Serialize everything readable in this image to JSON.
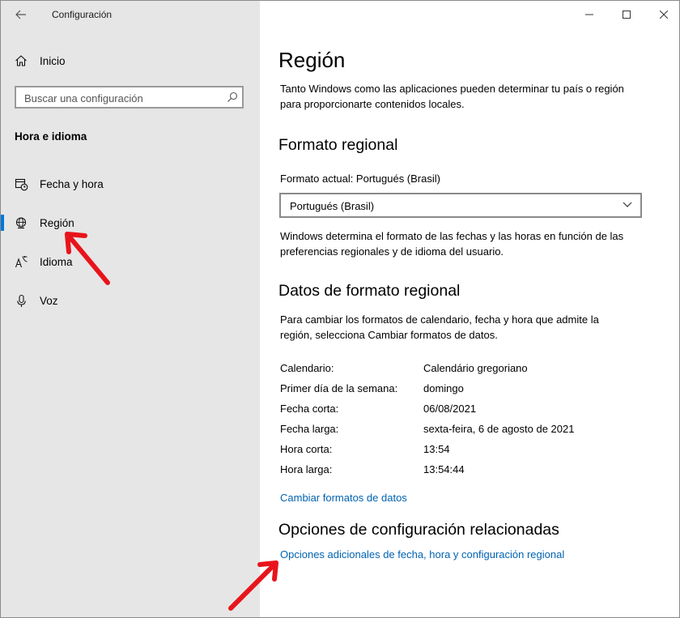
{
  "window": {
    "title": "Configuración"
  },
  "sidebar": {
    "home_label": "Inicio",
    "search_placeholder": "Buscar una configuración",
    "section_heading": "Hora e idioma",
    "items": [
      {
        "label": "Fecha y hora",
        "icon": "calendar-clock-icon",
        "selected": false
      },
      {
        "label": "Región",
        "icon": "globe-icon",
        "selected": true
      },
      {
        "label": "Idioma",
        "icon": "language-icon",
        "selected": false
      },
      {
        "label": "Voz",
        "icon": "microphone-icon",
        "selected": false
      }
    ]
  },
  "main": {
    "title": "Región",
    "intro": "Tanto Windows como las aplicaciones pueden determinar tu país o región para proporcionarte contenidos locales.",
    "regional_format": {
      "heading": "Formato regional",
      "current_label": "Formato actual: Portugués (Brasil)",
      "selected_value": "Portugués (Brasil)",
      "description": "Windows determina el formato de las fechas y las horas en función de las preferencias regionales y de idioma del usuario."
    },
    "format_data": {
      "heading": "Datos de formato regional",
      "description": "Para cambiar los formatos de calendario, fecha y hora que admite la región, selecciona Cambiar formatos de datos.",
      "rows": [
        {
          "key": "Calendario:",
          "value": "Calendário gregoriano"
        },
        {
          "key": "Primer día de la semana:",
          "value": "domingo"
        },
        {
          "key": "Fecha corta:",
          "value": "06/08/2021"
        },
        {
          "key": "Fecha larga:",
          "value": "sexta-feira, 6 de agosto de 2021"
        },
        {
          "key": "Hora corta:",
          "value": "13:54"
        },
        {
          "key": "Hora larga:",
          "value": "13:54:44"
        }
      ],
      "change_link": "Cambiar formatos de datos"
    },
    "related": {
      "heading": "Opciones de configuración relacionadas",
      "link": "Opciones adicionales de fecha, hora y configuración regional"
    }
  },
  "colors": {
    "accent": "#0078d7",
    "link": "#0063b1",
    "sidebar_bg": "#e6e6e6",
    "annotation_arrow": "#e8141b"
  }
}
